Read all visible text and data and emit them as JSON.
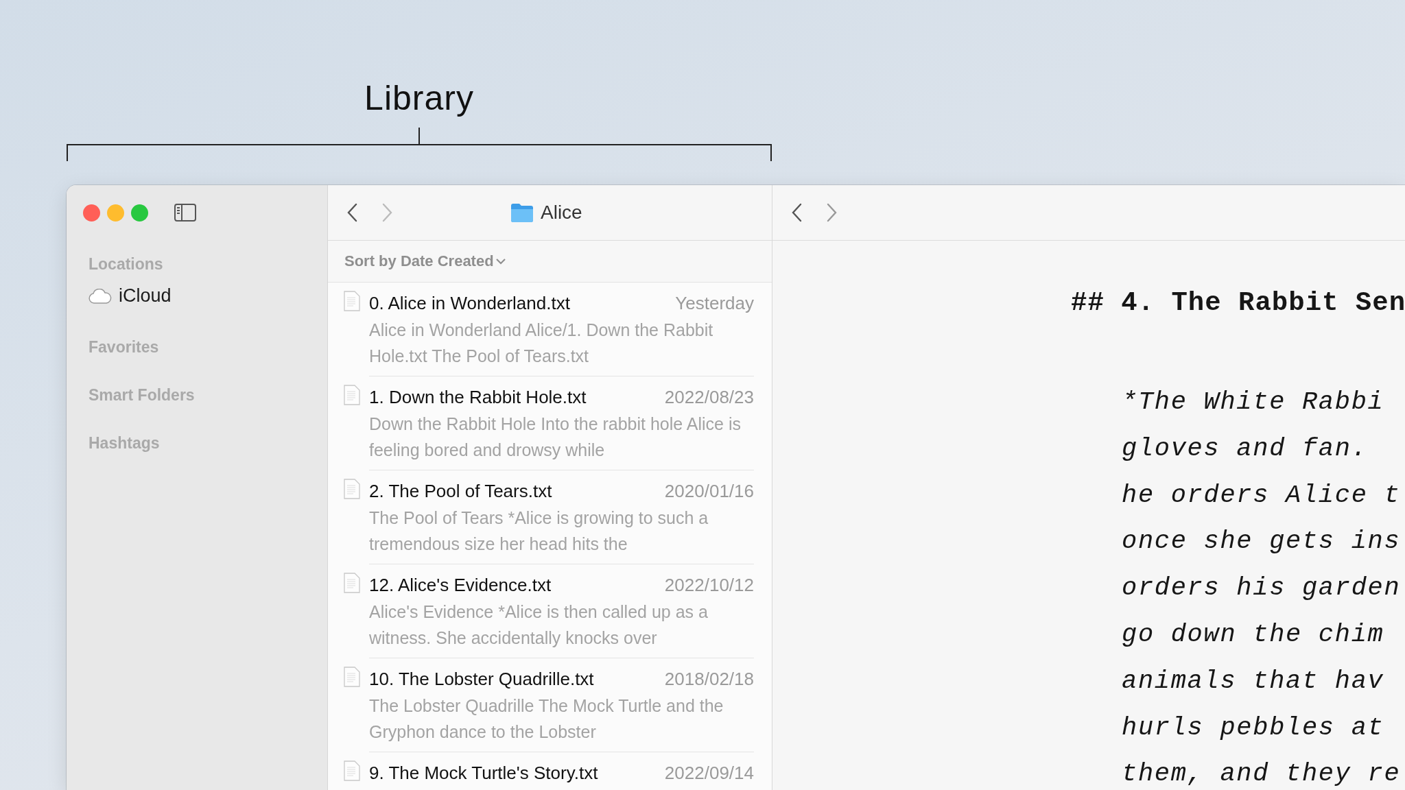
{
  "annotation": {
    "label": "Library"
  },
  "sidebar": {
    "sections": [
      {
        "title": "Locations",
        "items": [
          {
            "label": "iCloud"
          }
        ]
      },
      {
        "title": "Favorites"
      },
      {
        "title": "Smart Folders"
      },
      {
        "title": "Hashtags"
      }
    ]
  },
  "note_list": {
    "folder": "Alice",
    "sort": "Sort by Date Created",
    "notes": [
      {
        "title": "0. Alice in Wonderland.txt",
        "date": "Yesterday",
        "snippet": "Alice in Wonderland Alice/1. Down the Rabbit Hole.txt The Pool of Tears.txt"
      },
      {
        "title": "1. Down the Rabbit Hole.txt",
        "date": "2022/08/23",
        "snippet": "Down the Rabbit Hole Into the rabbit hole Alice is feeling bored and drowsy while"
      },
      {
        "title": "2. The Pool of Tears.txt",
        "date": "2020/01/16",
        "snippet": "The Pool of Tears *Alice is growing to such a tremendous size her head hits the"
      },
      {
        "title": "12. Alice's Evidence.txt",
        "date": "2022/10/12",
        "snippet": "Alice's Evidence *Alice is then called up as a witness. She accidentally knocks over"
      },
      {
        "title": "10. The Lobster Quadrille.txt",
        "date": "2018/02/18",
        "snippet": "The Lobster Quadrille The Mock Turtle and the Gryphon dance to the Lobster"
      },
      {
        "title": "9. The Mock Turtle's Story.txt",
        "date": "2022/09/14"
      }
    ]
  },
  "editor": {
    "heading": "## 4. The Rabbit Sen",
    "lines": [
      "*The White Rabbi",
      "gloves and fan.",
      "he orders Alice t",
      "once she gets ins",
      "orders his garden",
      "go down the chim",
      "animals that hav",
      "hurls pebbles at",
      "them, and they re"
    ]
  }
}
